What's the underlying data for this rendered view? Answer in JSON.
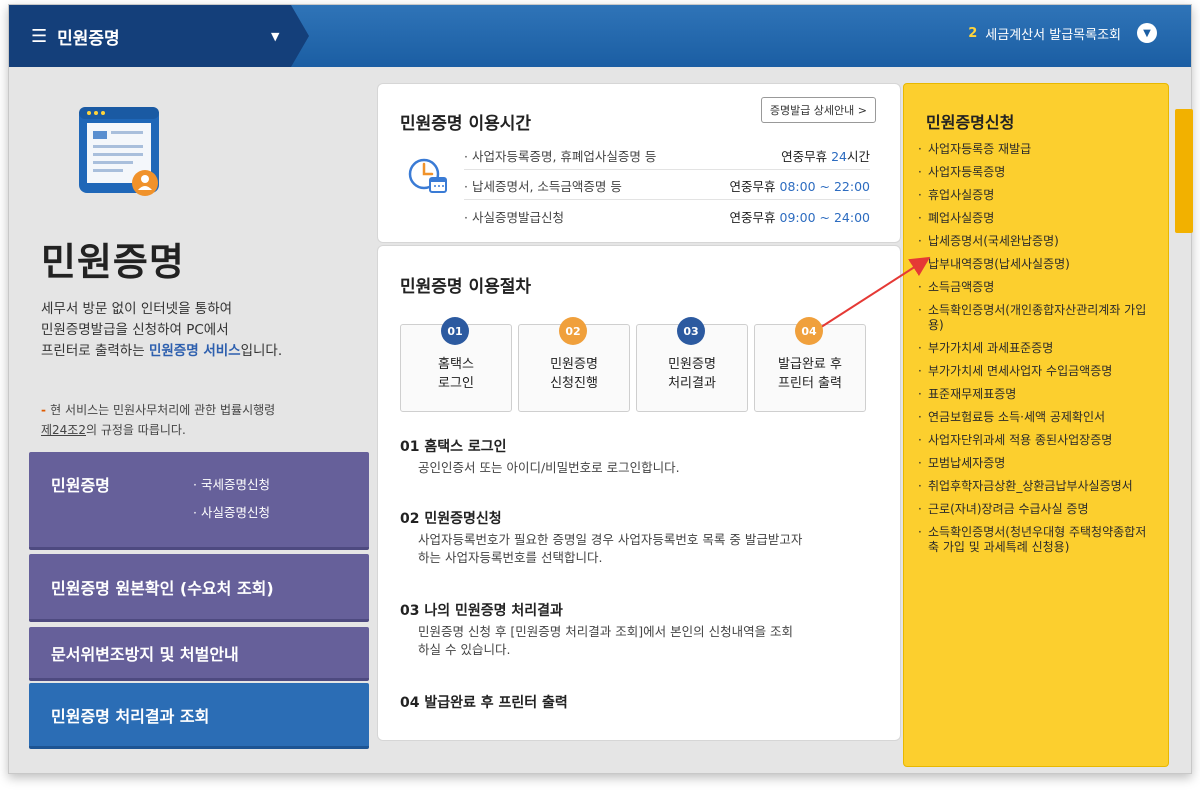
{
  "topbar": {
    "menu_title": "민원증명",
    "notice_num": "2",
    "notice_text": "세금계산서 발급목록조회"
  },
  "left": {
    "title": "민원증명",
    "desc_1": "세무서 방문 없이 인터넷을 통하여",
    "desc_2": "민원증명발급을 신청하여 PC에서",
    "desc_3_pre": "프린터로 출력하는 ",
    "desc_3_link": "민원증명 서비스",
    "desc_3_post": "입니다.",
    "law_1": "현 서비스는 민원사무처리에 관한 법률시행령",
    "law_2_u": "제24조2",
    "law_2_post": "의 규정을 따릅니다.",
    "nav": {
      "n1_title": "민원증명",
      "n1_sub1": "· 국세증명신청",
      "n1_sub2": "· 사실증명신청",
      "n2": "민원증명 원본확인 (수요처 조회)",
      "n3": "문서위변조방지 및 처벌안내",
      "n4": "민원증명 처리결과 조회"
    }
  },
  "hours": {
    "title": "민원증명 이용시간",
    "guide_btn": "증명발급 상세안내 >",
    "rows": [
      {
        "t": "· 사업자등록증명, 휴폐업사실증명 등",
        "v_pre": "연중무휴 ",
        "v_blue": "24",
        "v_post": "시간"
      },
      {
        "t": "· 납세증명서, 소득금액증명 등",
        "v_pre": "연중무휴 ",
        "v_blue": "08:00 ~ 22:00",
        "v_post": ""
      },
      {
        "t": "· 사실증명발급신청",
        "v_pre": "연중무휴 ",
        "v_blue": "09:00 ~ 24:00",
        "v_post": ""
      }
    ]
  },
  "process": {
    "title": "민원증명 이용절차",
    "steps": [
      {
        "num": "01",
        "l1": "홈택스",
        "l2": "로그인"
      },
      {
        "num": "02",
        "l1": "민원증명",
        "l2": "신청진행"
      },
      {
        "num": "03",
        "l1": "민원증명",
        "l2": "처리결과"
      },
      {
        "num": "04",
        "l1": "발급완료 후",
        "l2": "프린터 출력"
      }
    ],
    "s1_h": "01 홈택스 로그인",
    "s1_t": "공인인증서 또는 아이디/비밀번호로 로그인합니다.",
    "s2_h": "02 민원증명신청",
    "s2_t1": "사업자등록번호가 필요한 증명일 경우 사업자등록번호 목록 중 발급받고자",
    "s2_t2": "하는 사업자등록번호를 선택합니다.",
    "s3_h": "03 나의 민원증명 처리결과",
    "s3_t1": "민원증명 신청 후 [민원증명 처리결과 조회]에서 본인의 신청내역을 조회",
    "s3_t2": "하실 수 있습니다.",
    "s4_h": "04 발급완료 후 프린터 출력"
  },
  "apply": {
    "title": "민원증명신청",
    "items": [
      "사업자등록증 재발급",
      "사업자등록증명",
      "휴업사실증명",
      "폐업사실증명",
      "납세증명서(국세완납증명)",
      "납부내역증명(납세사실증명)",
      "소득금액증명",
      "소득확인증명서(개인종합자산관리계좌 가입용)",
      "부가가치세 과세표준증명",
      "부가가치세 면세사업자 수입금액증명",
      "표준재무제표증명",
      "연금보험료등 소득·세액 공제확인서",
      "사업자단위과세 적용 종된사업장증명",
      "모범납세자증명",
      "취업후학자금상환_상환금납부사실증명서",
      "근로(자녀)장려금 수급사실 증명",
      "소득확인증명서(청년우대형 주택청약종합저축 가입 및 과세특례 신청용)"
    ]
  },
  "colors": {
    "topbar": "#1b5ea3",
    "nav_purple": "#66609a",
    "nav_blue": "#2b6db5",
    "apply_yellow": "#fccf2e",
    "step1": "#2c5aa0",
    "step2": "#f0a03c",
    "step3": "#2c5aa0",
    "step4": "#f0a03c",
    "arrow": "#e53935"
  }
}
